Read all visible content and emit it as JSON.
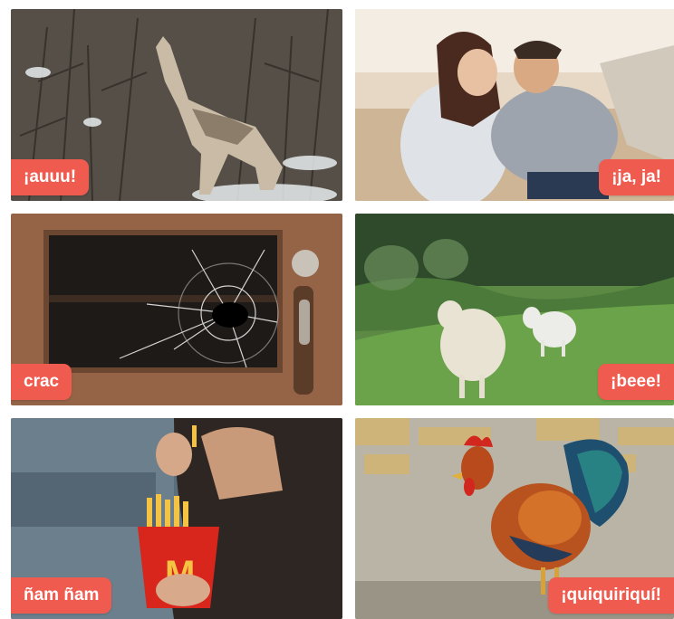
{
  "accent_color": "#ef5b4f",
  "tiles": [
    {
      "label": "¡auuu!",
      "icon": "wolf-howling",
      "label_side": "left"
    },
    {
      "label": "¡ja, ja!",
      "icon": "couple-laughing",
      "label_side": "right"
    },
    {
      "label": "crac",
      "icon": "broken-glass",
      "label_side": "left"
    },
    {
      "label": "¡beee!",
      "icon": "sheep",
      "label_side": "right"
    },
    {
      "label": "ñam ñam",
      "icon": "person-eating-fries",
      "label_side": "left"
    },
    {
      "label": "¡quiquiriquí!",
      "icon": "rooster",
      "label_side": "right"
    }
  ]
}
